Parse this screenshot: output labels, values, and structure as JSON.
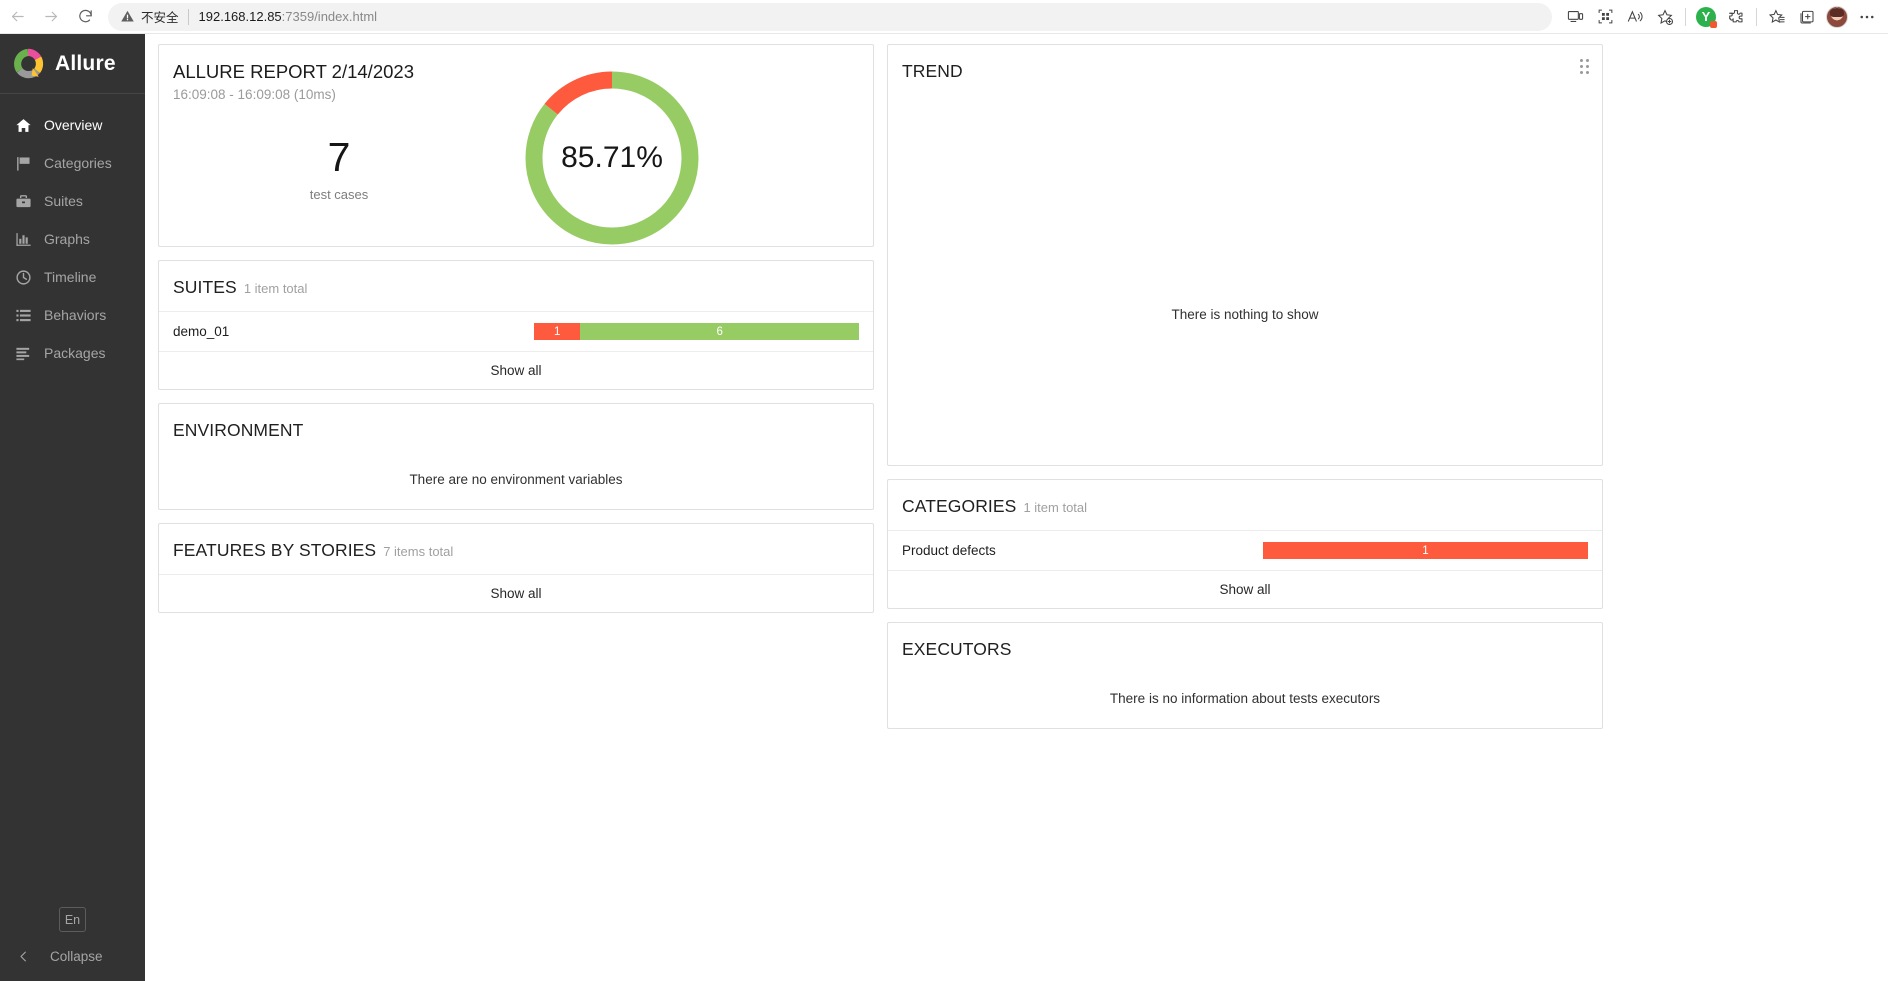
{
  "browser": {
    "back_icon": "back-arrow-icon",
    "forward_icon": "forward-arrow-icon",
    "reload_icon": "reload-icon",
    "security_label": "不安全",
    "url_host": "192.168.12.85",
    "url_path": ":7359/index.html",
    "toolbar_icons": [
      "device-cast-icon",
      "qr-code-icon",
      "read-aloud-icon",
      "add-favorite-icon",
      "extension-badge-icon",
      "extensions-puzzle-icon",
      "favorites-list-icon",
      "collections-icon",
      "profile-avatar",
      "settings-more-icon"
    ],
    "extension_badge_letter": "Y"
  },
  "sidebar": {
    "brand": "Allure",
    "items": [
      {
        "label": "Overview",
        "icon": "home-icon",
        "active": true
      },
      {
        "label": "Categories",
        "icon": "flag-icon",
        "active": false
      },
      {
        "label": "Suites",
        "icon": "briefcase-icon",
        "active": false
      },
      {
        "label": "Graphs",
        "icon": "bar-chart-icon",
        "active": false
      },
      {
        "label": "Timeline",
        "icon": "clock-icon",
        "active": false
      },
      {
        "label": "Behaviors",
        "icon": "list-icon",
        "active": false
      },
      {
        "label": "Packages",
        "icon": "layers-icon",
        "active": false
      }
    ],
    "language": "En",
    "collapse_label": "Collapse",
    "collapse_icon": "chevron-left-icon"
  },
  "colors": {
    "passed": "#97cc64",
    "failed": "#fd5a3e",
    "accent": "#4aa3df",
    "sidebar_bg": "#333333"
  },
  "summary": {
    "title": "ALLURE REPORT 2/14/2023",
    "time_range": "16:09:08 - 16:09:08 (10ms)",
    "test_count": "7",
    "test_count_label": "test cases",
    "pass_rate": "85.71%"
  },
  "suites": {
    "title": "SUITES",
    "subtitle": "1 item total",
    "show_all": "Show all",
    "rows": [
      {
        "name": "demo_01",
        "segments": [
          {
            "label": "1",
            "value": 1,
            "status": "failed"
          },
          {
            "label": "6",
            "value": 6,
            "status": "passed"
          }
        ]
      }
    ]
  },
  "environment": {
    "title": "ENVIRONMENT",
    "empty_text": "There are no environment variables"
  },
  "features": {
    "title": "FEATURES BY STORIES",
    "subtitle": "7 items total",
    "show_all": "Show all"
  },
  "trend": {
    "title": "TREND",
    "empty_text": "There is nothing to show",
    "drag_handle_icon": "drag-handle-icon"
  },
  "categories": {
    "title": "CATEGORIES",
    "subtitle": "1 item total",
    "show_all": "Show all",
    "rows": [
      {
        "name": "Product defects",
        "segments": [
          {
            "label": "1",
            "value": 1,
            "status": "failed"
          }
        ]
      }
    ]
  },
  "executors": {
    "title": "EXECUTORS",
    "empty_text": "There is no information about tests executors"
  },
  "chart_data": {
    "type": "pie",
    "title": "Test results pass rate",
    "labels": [
      "passed",
      "failed"
    ],
    "values": [
      6,
      1
    ],
    "percentages": [
      85.71,
      14.29
    ],
    "colors": [
      "#97cc64",
      "#fd5a3e"
    ],
    "center_label": "85.71%",
    "total": 7,
    "legend": "none"
  }
}
